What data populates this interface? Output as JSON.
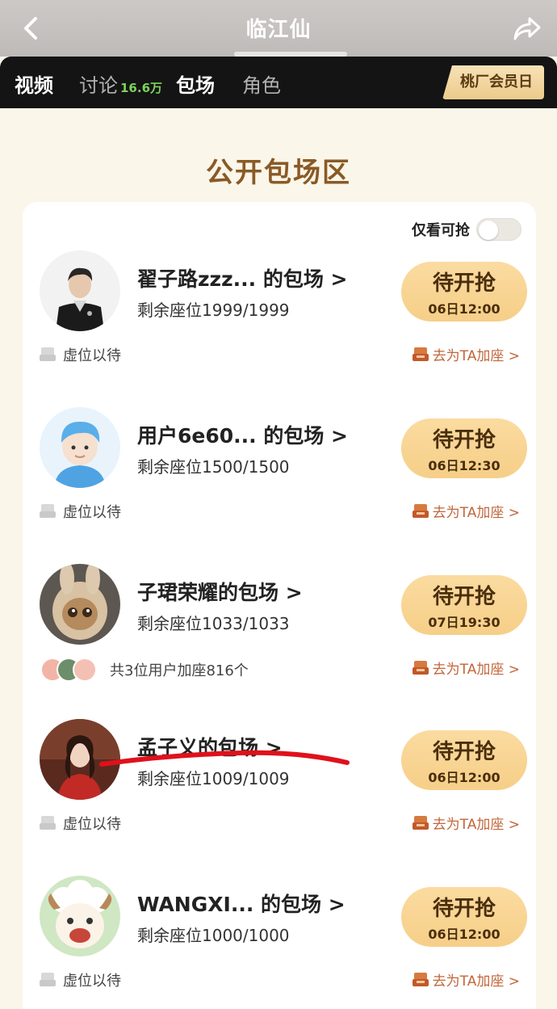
{
  "header": {
    "title": "临江仙"
  },
  "tabs": [
    {
      "label": "视频",
      "active": true
    },
    {
      "label": "讨论",
      "count": "16.6万",
      "active": false
    },
    {
      "label": "包场",
      "active": true
    },
    {
      "label": "角色",
      "active": false
    }
  ],
  "member_day": "桃厂会员日",
  "section_title": "公开包场区",
  "filter": {
    "label": "仅看可抢",
    "enabled": false
  },
  "screenings": [
    {
      "name": "翟子路zzz... 的包场 >",
      "seats": "剩余座位1999/1999",
      "status": "待开抢",
      "time": "06日12:00",
      "footer": "虚位以待",
      "action": "去为TA加座 >",
      "avatar": "man-portrait"
    },
    {
      "name": "用户6e60... 的包场 >",
      "seats": "剩余座位1500/1500",
      "status": "待开抢",
      "time": "06日12:30",
      "footer": "虚位以待",
      "action": "去为TA加座 >",
      "avatar": "default-user-avatar"
    },
    {
      "name": "子珺荣耀的包场 >",
      "seats": "剩余座位1033/1033",
      "status": "待开抢",
      "time": "07日19:30",
      "footer": "共3位用户加座816个",
      "action": "去为TA加座 >",
      "avatar": "plush-toy"
    },
    {
      "name": "孟子义的包场 >",
      "seats": "剩余座位1009/1009",
      "status": "待开抢",
      "time": "06日12:00",
      "footer": "虚位以待",
      "action": "去为TA加座 >",
      "avatar": "woman-red-dress"
    },
    {
      "name": "WANGXI... 的包场 >",
      "seats": "剩余座位1000/1000",
      "status": "待开抢",
      "time": "06日12:00",
      "footer": "虚位以待",
      "action": "去为TA加座 >",
      "avatar": "cartoon-sheep"
    }
  ],
  "colors": {
    "tab_bg": "#141414",
    "grab_button": "#f8d593",
    "section_title": "#8a5a25",
    "action_link": "#c0663a",
    "count_green": "#7cd35a",
    "annotation_red": "#e0111b"
  }
}
